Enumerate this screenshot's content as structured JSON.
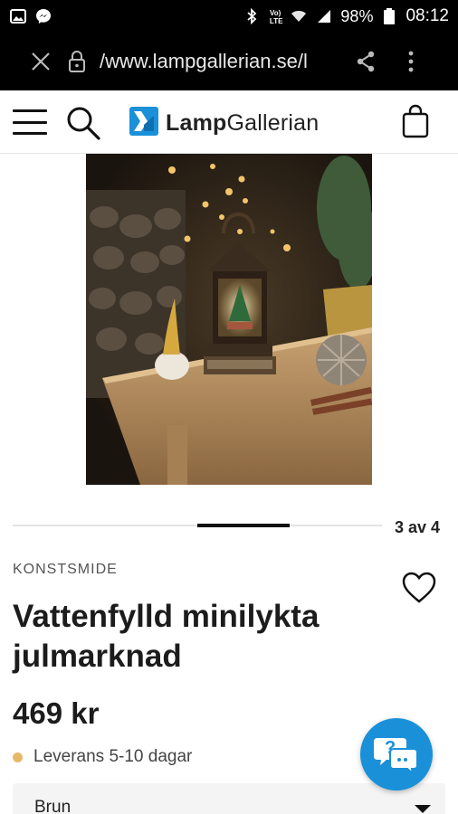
{
  "status_bar": {
    "time": "08:12",
    "battery": "98%",
    "network": "LTE",
    "icons": [
      "gallery-icon",
      "messenger-icon",
      "bluetooth-icon",
      "volte-icon",
      "wifi-icon",
      "signal-icon",
      "battery-icon"
    ]
  },
  "browser": {
    "url": "/www.lampgallerian.se/l",
    "icons": [
      "close-icon",
      "lock-icon",
      "share-icon",
      "overflow-menu-icon"
    ]
  },
  "header": {
    "logo_bold": "Lamp",
    "logo_light": "Gallerian",
    "icons": [
      "hamburger-menu-icon",
      "search-icon",
      "logo-icon",
      "shopping-bag-icon"
    ],
    "colors": {
      "logo_mark": "#1a90d9"
    }
  },
  "gallery": {
    "counter": "3 av 4",
    "current": 3,
    "total": 4
  },
  "product": {
    "brand": "KONSTSMIDE",
    "title_line1": "Vattenfylld minilykta",
    "title_line2": "julmarknad",
    "price": "469 kr",
    "delivery": "Leverans 5-10 dagar",
    "variant": "Brun",
    "colors": {
      "delivery_dot": "#e8b86a"
    }
  },
  "chat": {
    "label": "?",
    "icons": [
      "chat-help-icon"
    ],
    "colors": {
      "fab": "#1a90d9"
    }
  }
}
